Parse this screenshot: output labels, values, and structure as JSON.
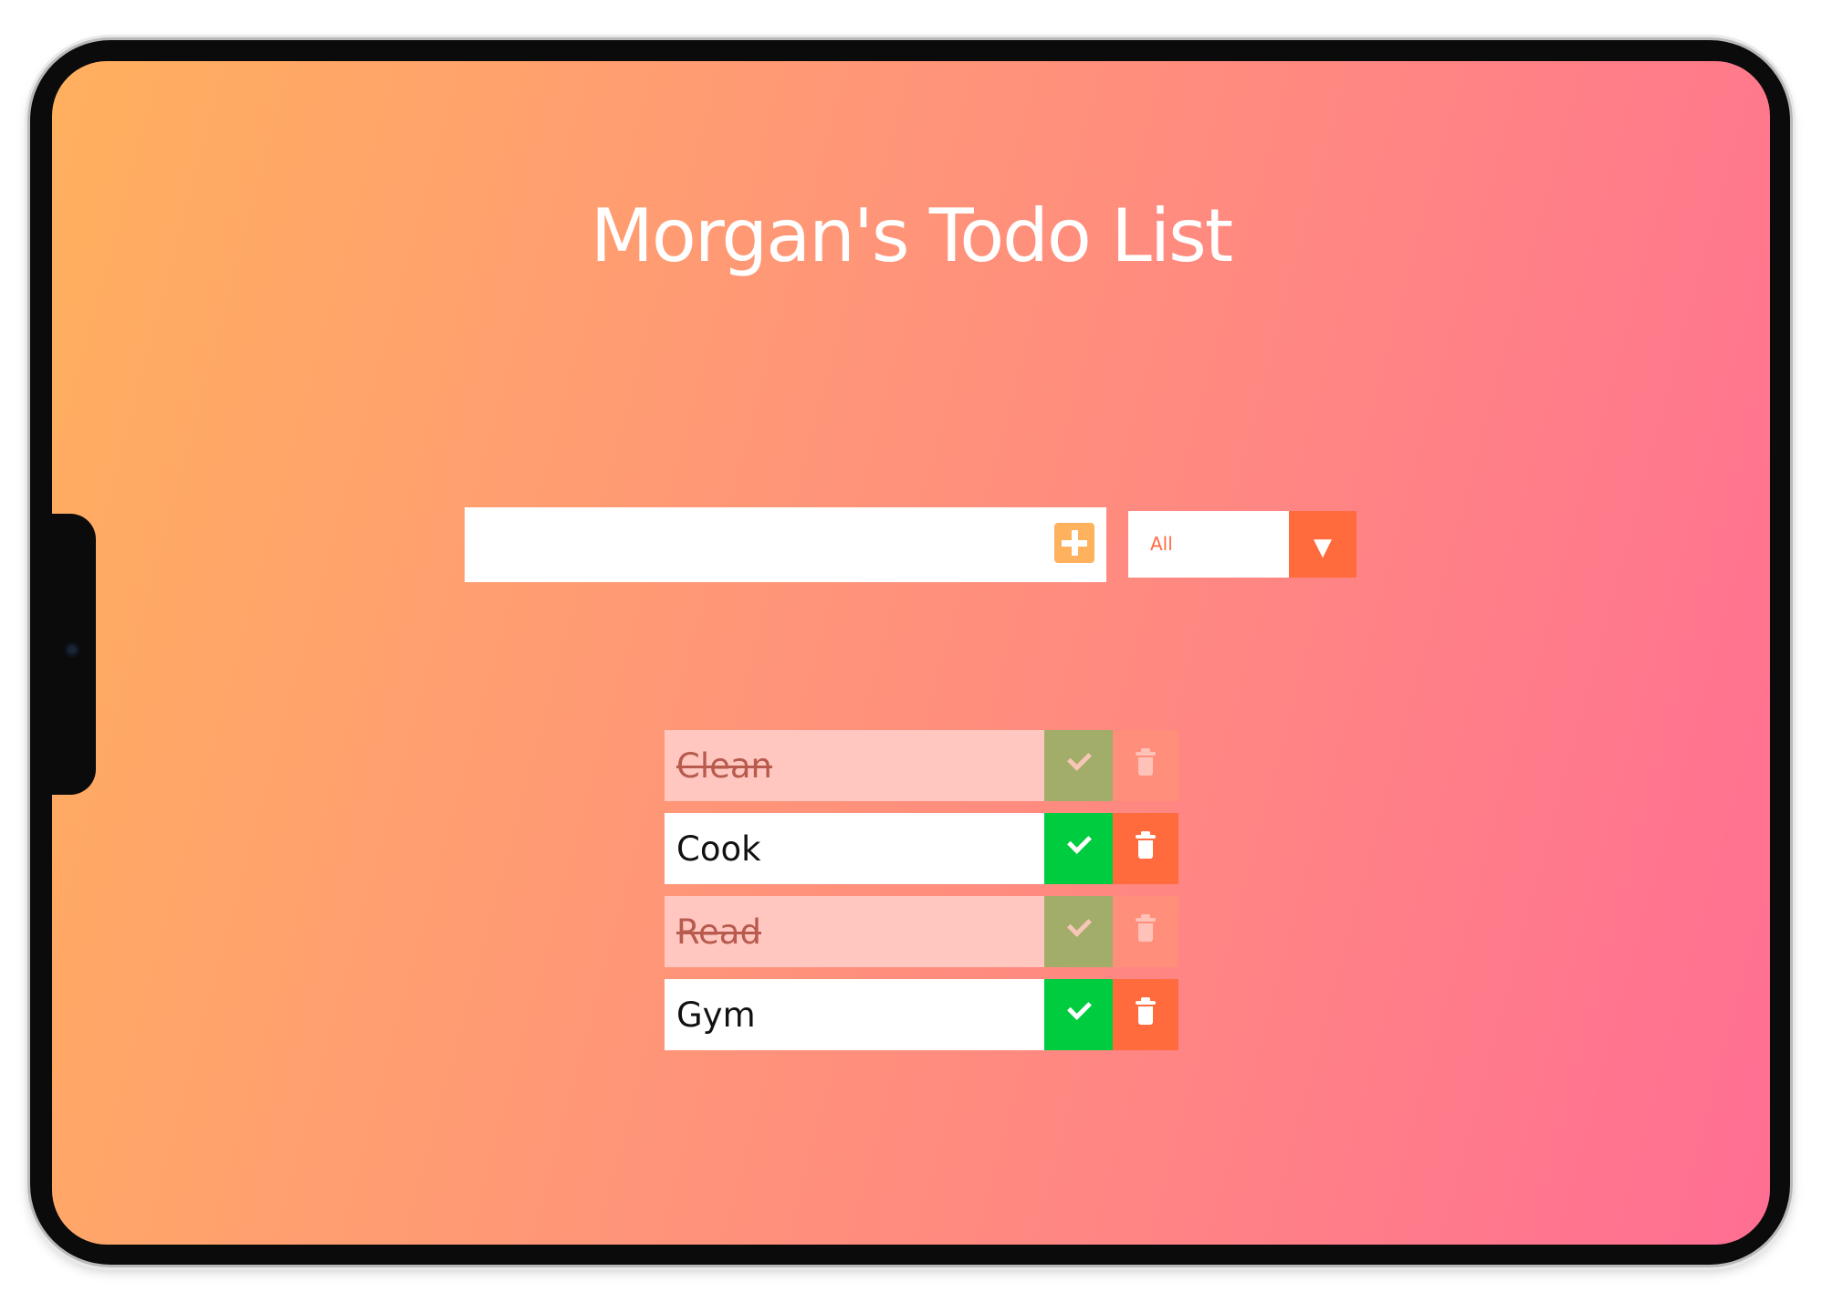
{
  "app": {
    "title": "Morgan's Todo List"
  },
  "input": {
    "value": "",
    "placeholder": ""
  },
  "filter": {
    "selected": "All",
    "arrow": "▼"
  },
  "todos": [
    {
      "text": "Clean",
      "completed": true
    },
    {
      "text": "Cook",
      "completed": false
    },
    {
      "text": "Read",
      "completed": true
    },
    {
      "text": "Gym",
      "completed": false
    }
  ],
  "icons": {
    "add": "plus-square-icon",
    "complete": "check-icon",
    "delete": "trash-icon",
    "dropdown": "caret-down-icon"
  },
  "colors": {
    "gradient_start": "#ffb05e",
    "gradient_end": "#ff6e93",
    "add_button": "#ffb25e",
    "complete_button": "#00cc3f",
    "delete_button": "#ff6b3d",
    "completed_item_background": "#ffc7c0"
  }
}
